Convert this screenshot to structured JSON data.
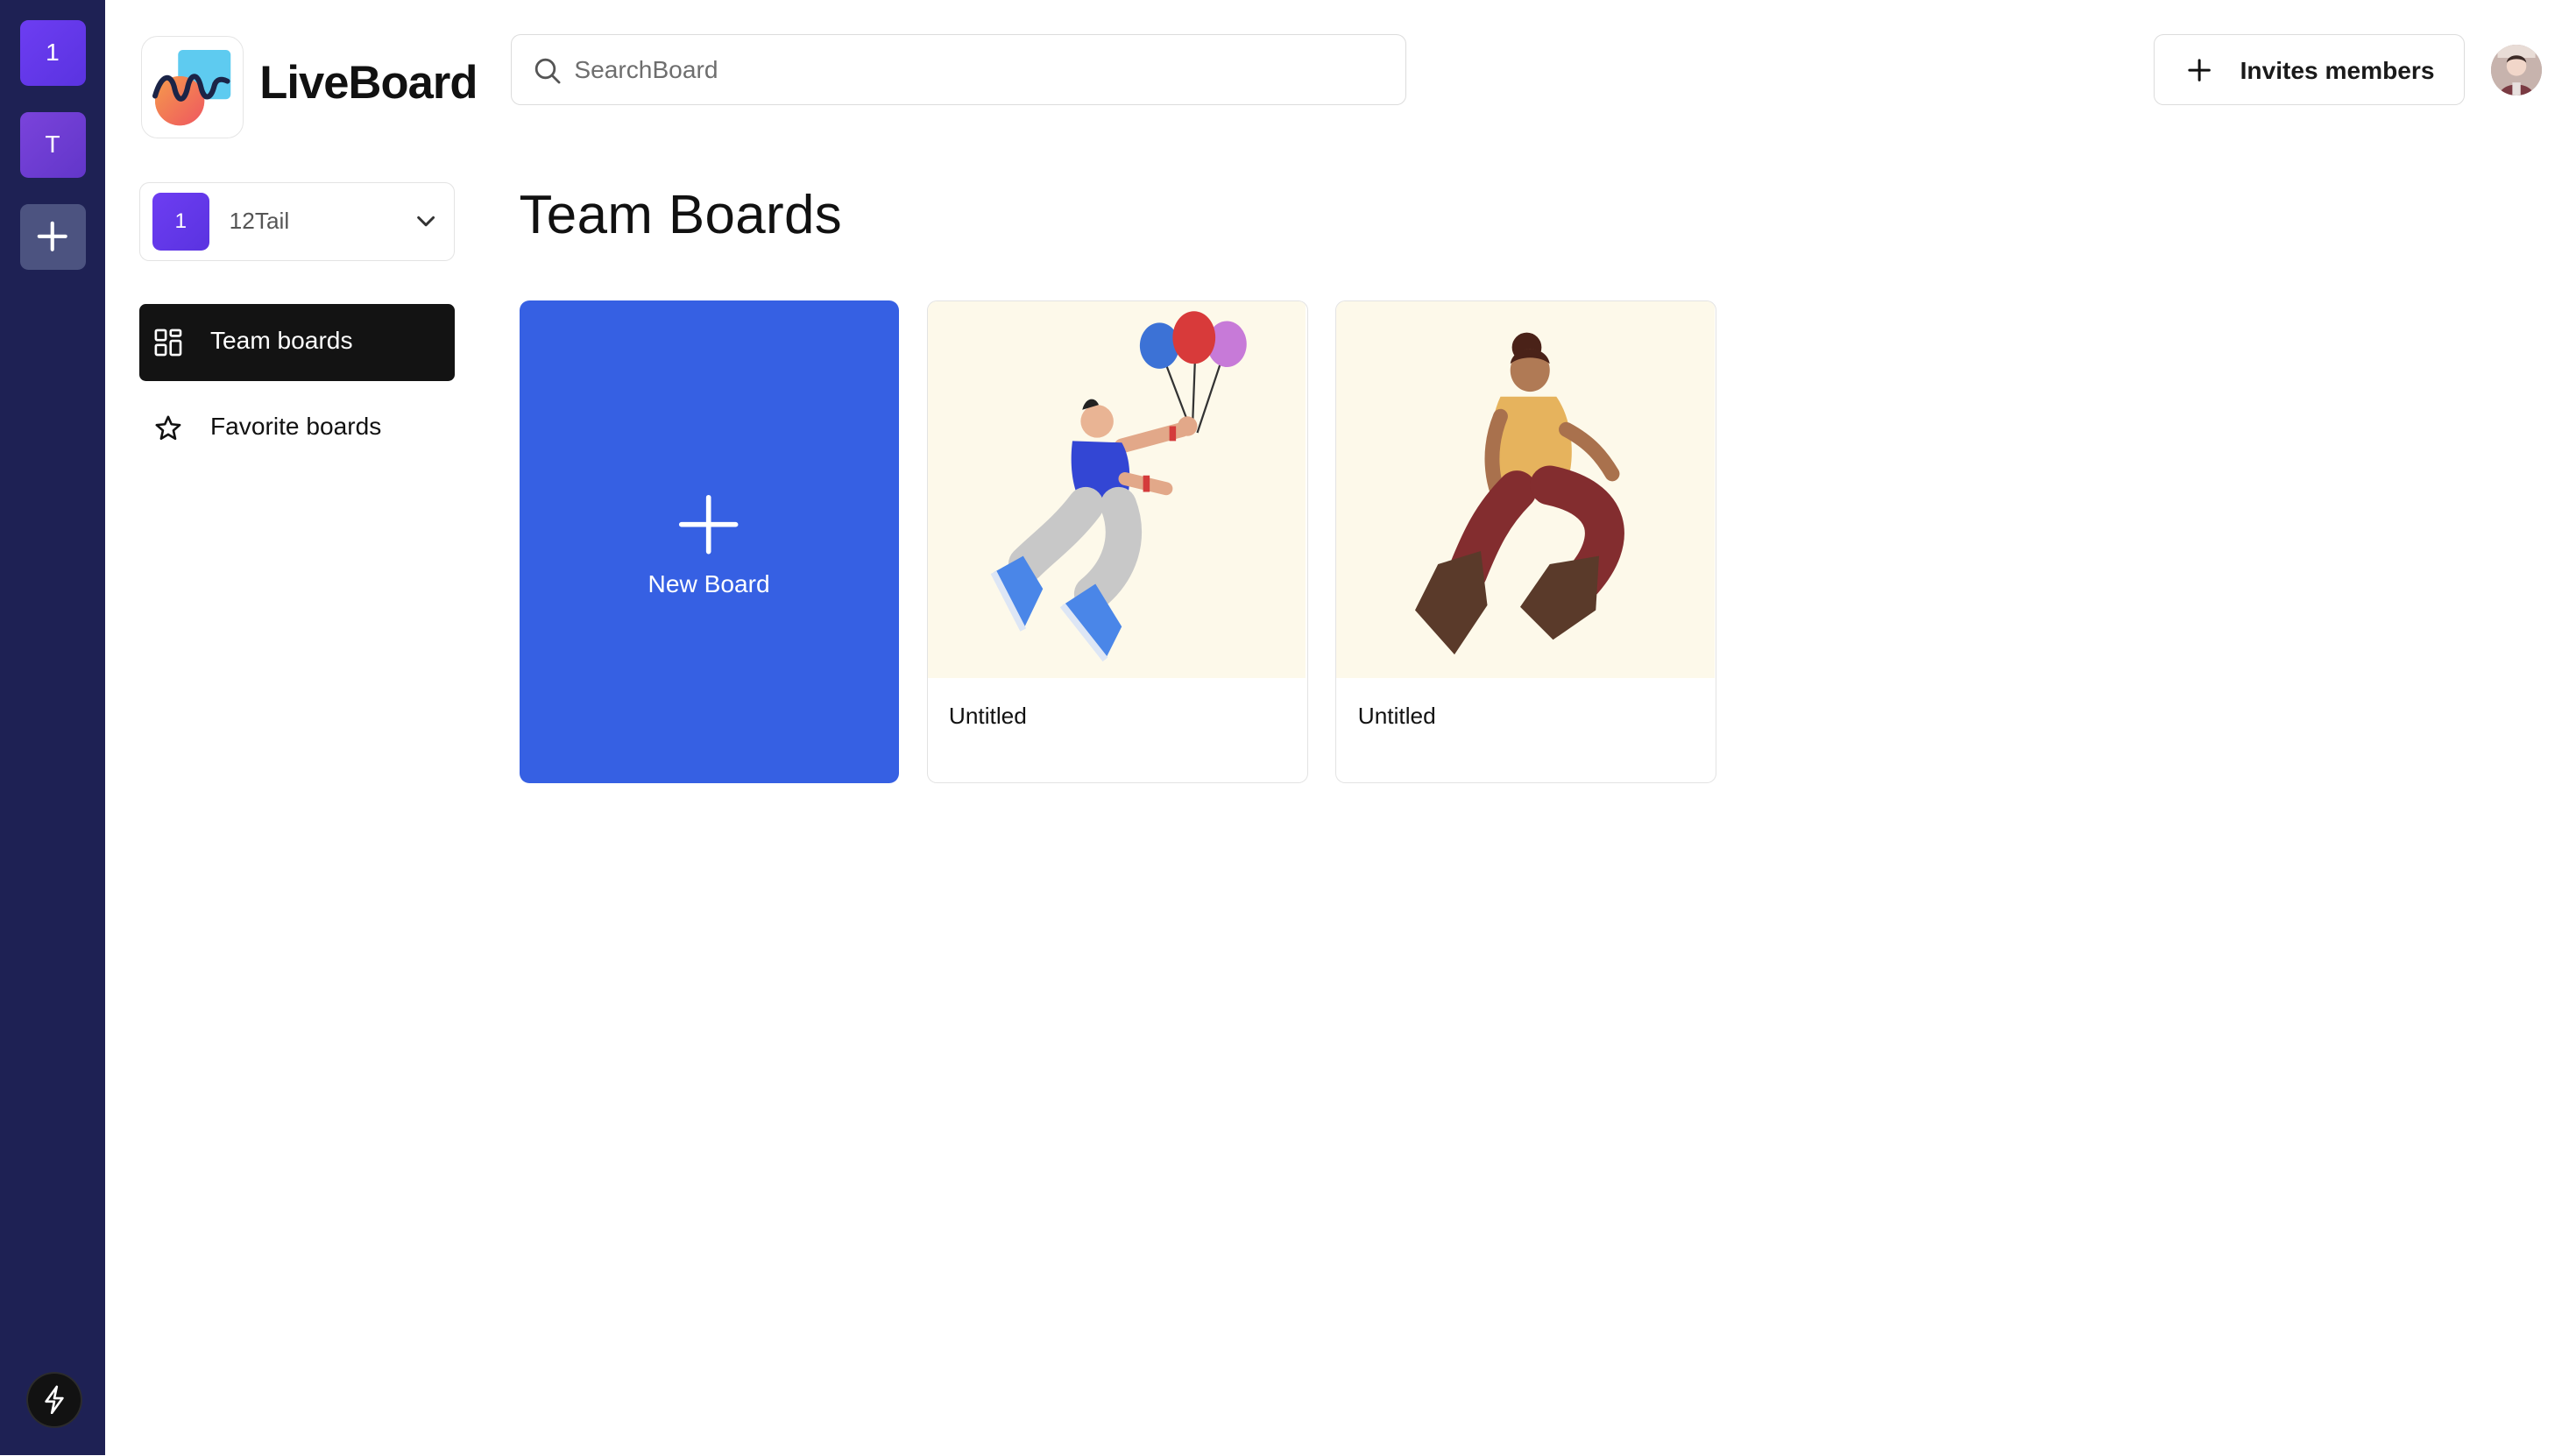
{
  "rail": {
    "orgs": [
      {
        "initial": "1",
        "color": "#6d3df2"
      },
      {
        "initial": "T",
        "color": "#7a43db"
      }
    ],
    "add_icon": "plus-icon",
    "bottom_icon": "bolt-icon"
  },
  "brand": {
    "name": "LiveBoard",
    "logo_icon": "liveboard-logo"
  },
  "org_switcher": {
    "badge": "1",
    "name": "12Tail",
    "icon": "chevron-down-icon"
  },
  "nav": {
    "items": [
      {
        "label": "Team boards",
        "icon": "grid-icon",
        "active": true
      },
      {
        "label": "Favorite boards",
        "icon": "star-icon",
        "active": false
      }
    ]
  },
  "search": {
    "placeholder": "SearchBoard",
    "value": "",
    "icon": "search-icon"
  },
  "header": {
    "invite_label": "Invites members",
    "invite_icon": "plus-icon",
    "avatar": "user-avatar"
  },
  "main": {
    "title": "Team Boards",
    "new_board_label": "New Board",
    "boards": [
      {
        "title": "Untitled",
        "thumbnail": "balloon-person-illustration"
      },
      {
        "title": "Untitled",
        "thumbnail": "jumping-person-illustration"
      }
    ]
  },
  "colors": {
    "rail_bg": "#1e2154",
    "accent": "#3660e3",
    "nav_active_bg": "#131313",
    "thumbnail_bg": "#fdf9ea"
  }
}
